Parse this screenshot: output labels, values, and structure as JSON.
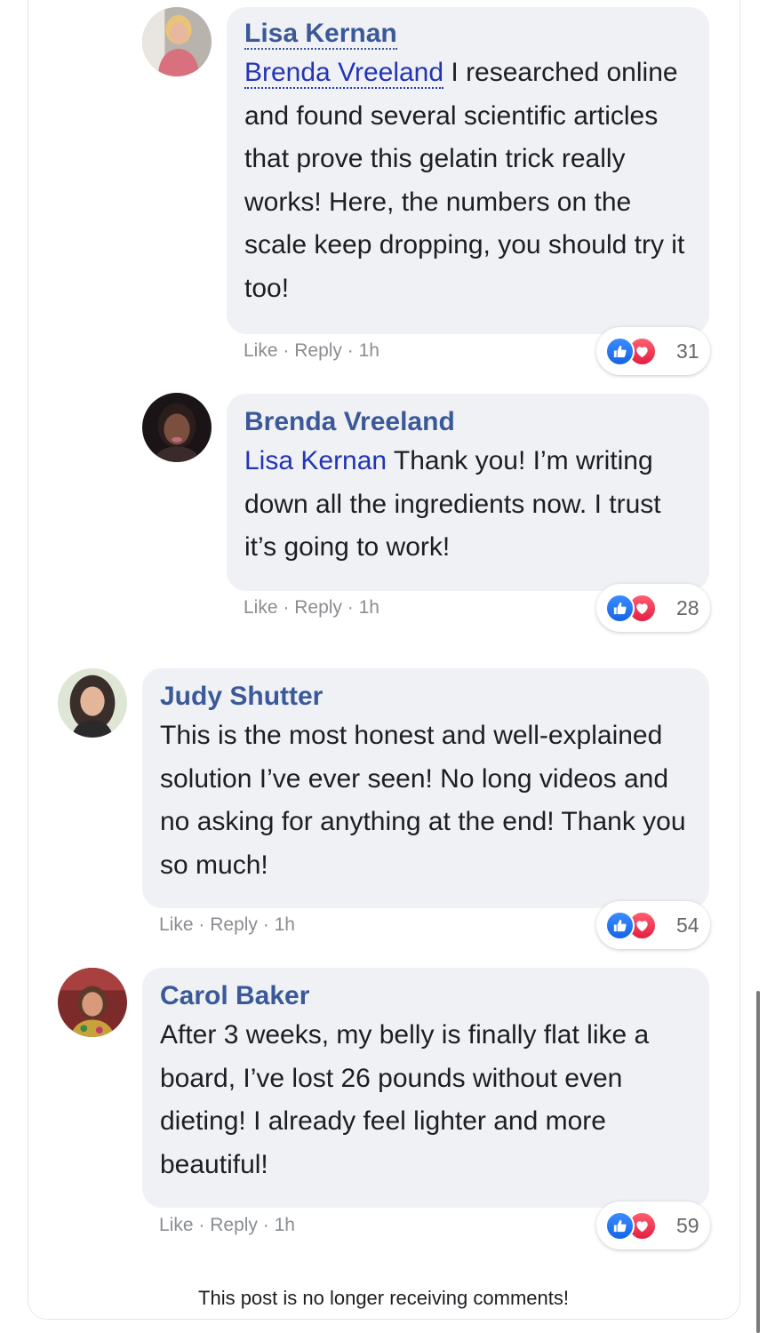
{
  "comments": [
    {
      "author": "Lisa Kernan",
      "mention": "Brenda Vreeland",
      "text": " I researched online and found several scientific articles that prove this gelatin trick really works! Here, the numbers on the scale keep dropping, you should try it too!",
      "actions": {
        "like": "Like",
        "sep1": "·",
        "reply": "Reply",
        "sep2": "·",
        "time": "1h"
      },
      "reaction_count": "31",
      "reactions": [
        "like-icon",
        "love-icon"
      ]
    },
    {
      "author": "Brenda Vreeland",
      "mention": "Lisa Kernan",
      "text": " Thank you! I’m writing down all the ingredients now. I trust it’s going to work!",
      "actions": {
        "like": "Like",
        "sep1": "·",
        "reply": "Reply",
        "sep2": "·",
        "time": "1h"
      },
      "reaction_count": "28",
      "reactions": [
        "like-icon",
        "love-icon"
      ]
    },
    {
      "author": "Judy Shutter",
      "text": "This is the most honest and well-explained solution I’ve ever seen! No long videos and no asking for anything at the end! Thank you so much!",
      "actions": {
        "like": "Like",
        "sep1": "·",
        "reply": "Reply",
        "sep2": "·",
        "time": "1h"
      },
      "reaction_count": "54",
      "reactions": [
        "like-icon",
        "love-icon"
      ]
    },
    {
      "author": "Carol Baker",
      "text": "After 3 weeks, my belly is finally flat like a board, I’ve lost 26 pounds without even dieting! I already feel lighter and more beautiful!",
      "actions": {
        "like": "Like",
        "sep1": "·",
        "reply": "Reply",
        "sep2": "·",
        "time": "1h"
      },
      "reaction_count": "59",
      "reactions": [
        "like-icon",
        "love-icon"
      ]
    }
  ],
  "footer": {
    "closed_notice": "This post is no longer receiving comments!"
  },
  "colors": {
    "author": "#3b5998",
    "mention": "#2334b6",
    "bubble": "#eff1f5",
    "like": "#1877f2",
    "love": "#e41e3f",
    "meta": "#8a8d91"
  }
}
